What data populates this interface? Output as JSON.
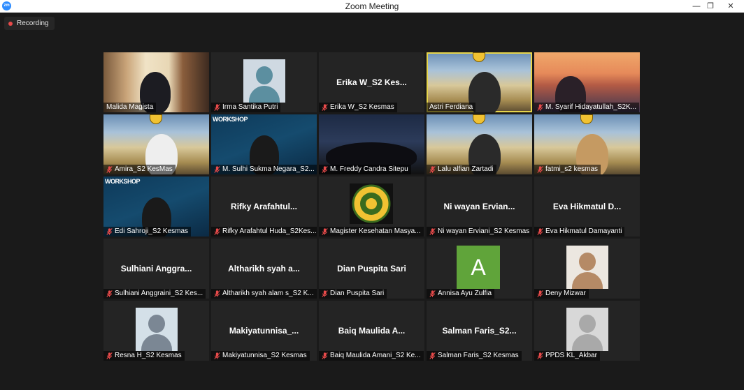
{
  "window": {
    "title": "Zoom Meeting",
    "app_icon": "zm",
    "controls": [
      "minimize-icon",
      "restore-icon",
      "close-icon"
    ]
  },
  "recording": {
    "label": "Recording",
    "dot_color": "#e84a4a"
  },
  "colors": {
    "active_speaker": "#e6d54b",
    "muted_mic": "#e84a4a",
    "tile_bg": "#242424"
  },
  "participants": [
    {
      "label": "Malida Magista",
      "center": "",
      "muted": false,
      "video": "room"
    },
    {
      "label": "Irma Santika Putri",
      "center": "",
      "muted": true,
      "video": "photo-hijab"
    },
    {
      "label": "Erika W_S2 Kesmas",
      "center": "Erika W_S2 Kes...",
      "muted": true,
      "video": "none"
    },
    {
      "label": "Astri Ferdiana",
      "center": "",
      "muted": false,
      "video": "campus",
      "active": true
    },
    {
      "label": "M. Syarif Hidayatullah_S2K...",
      "center": "",
      "muted": true,
      "video": "bridge"
    },
    {
      "label": "Amira_S2 KesMas",
      "center": "",
      "muted": true,
      "video": "campus"
    },
    {
      "label": "M. Sulhi Sukma Negara_S2...",
      "center": "",
      "muted": true,
      "video": "workshop",
      "overlay": "WORKSHOP"
    },
    {
      "label": "M. Freddy Candra Sitepu",
      "center": "",
      "muted": true,
      "video": "group"
    },
    {
      "label": "Lalu alfian Zartadi",
      "center": "",
      "muted": true,
      "video": "campus"
    },
    {
      "label": "fatmi_s2 kesmas",
      "center": "",
      "muted": true,
      "video": "campus"
    },
    {
      "label": "Edi Sahroji_S2 Kesmas",
      "center": "",
      "muted": true,
      "video": "workshop",
      "overlay": "WORKSHOP"
    },
    {
      "label": "Rifky Arafahtul Huda_S2Kes...",
      "center": "Rifky  Arafahtul...",
      "muted": true,
      "video": "none"
    },
    {
      "label": "Magister Kesehatan Masya...",
      "center": "",
      "muted": true,
      "video": "logo"
    },
    {
      "label": "Ni wayan Erviani_S2 Kesmas",
      "center": "Ni wayan Ervian...",
      "muted": true,
      "video": "none"
    },
    {
      "label": "Eva Hikmatul Damayanti",
      "center": "Eva Hikmatul D...",
      "muted": true,
      "video": "none"
    },
    {
      "label": "Sulhiani Anggraini_S2 Kes...",
      "center": "Sulhiani  Anggra...",
      "muted": true,
      "video": "none"
    },
    {
      "label": "Altharikh syah alam s_S2 K...",
      "center": "Altharikh syah a...",
      "muted": true,
      "video": "none"
    },
    {
      "label": "Dian Puspita Sari",
      "center": "Dian Puspita Sari",
      "muted": true,
      "video": "none"
    },
    {
      "label": "Annisa Ayu Zulfia",
      "center": "",
      "muted": true,
      "video": "letter",
      "letter": "A"
    },
    {
      "label": "Deny Mizwar",
      "center": "",
      "muted": true,
      "video": "photo-feet"
    },
    {
      "label": "Resna H_S2 Kesmas",
      "center": "",
      "muted": true,
      "video": "photo-hijab2"
    },
    {
      "label": "Makiyatunnisa_S2 Kesmas",
      "center": "Makiyatunnisa_...",
      "muted": true,
      "video": "none"
    },
    {
      "label": "Baiq Maulida Amani_S2 Ke...",
      "center": "Baiq Maulida A...",
      "muted": true,
      "video": "none"
    },
    {
      "label": "Salman Faris_S2 Kesmas",
      "center": "Salman  Faris_S2...",
      "muted": true,
      "video": "none"
    },
    {
      "label": "PPDS KL_Akbar",
      "center": "",
      "muted": true,
      "video": "default-avatar"
    }
  ]
}
